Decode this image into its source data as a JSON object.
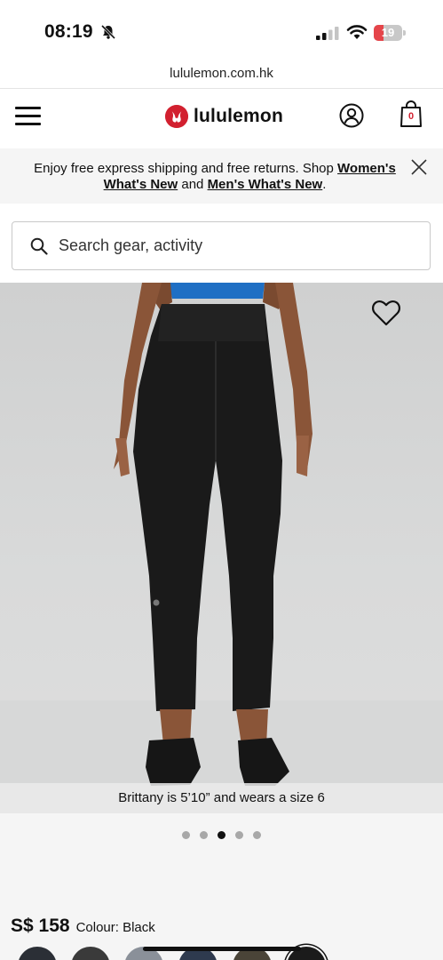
{
  "status_bar": {
    "time": "08:19",
    "battery_level": "19",
    "icons": [
      "bell-slash-icon",
      "cellular-signal-icon",
      "wifi-icon",
      "battery-icon"
    ]
  },
  "browser": {
    "url": "lululemon.com.hk"
  },
  "header": {
    "brand": "lululemon",
    "bag_count": "0",
    "icons": [
      "hamburger-menu-icon",
      "lululemon-logo-icon",
      "account-icon",
      "shopping-bag-icon"
    ]
  },
  "promo": {
    "text_before": "Enjoy free express shipping and free returns. Shop ",
    "womens_link": "Women's What's New",
    "middle": " and ",
    "mens_link": "Men's What's New",
    "text_after": "."
  },
  "search": {
    "placeholder": "Search gear, activity",
    "value": ""
  },
  "product": {
    "image_caption": "Brittany is 5’10” and wears a size 6",
    "carousel": {
      "total": 5,
      "active_index": 2
    },
    "price": "S$ 158",
    "colour_label": "Colour: Black",
    "swatch_colors": [
      "#2b2f36",
      "#3a3a3a",
      "#8a9099",
      "#2e3a4e",
      "#4a4438",
      "#1b1b1b"
    ]
  },
  "colors": {
    "brand_red": "#d2202f",
    "text": "#111111",
    "banner_bg": "#f5f5f5"
  }
}
